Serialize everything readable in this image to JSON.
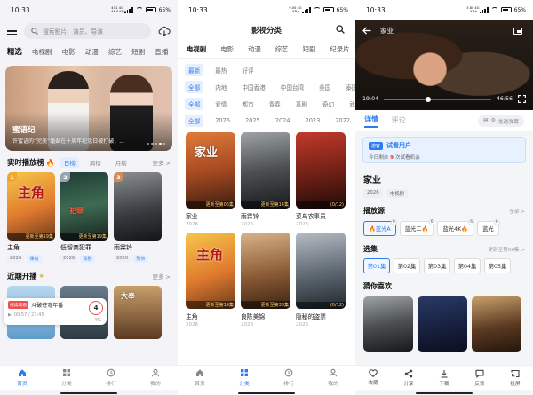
{
  "status": [
    {
      "time": "10:33",
      "net": "4G1 4G\n46.0 KB/s",
      "battery": "65%"
    },
    {
      "time": "10:33",
      "net": "9.00 4G\nKB/s",
      "battery": "65%"
    },
    {
      "time": "10:33",
      "net": "3.80 4G\nKB/s",
      "battery": "65%"
    }
  ],
  "home": {
    "search_placeholder": "搜索影片、演员、导演",
    "tabs": [
      "精选",
      "电视剧",
      "电影",
      "动漫",
      "综艺",
      "短剧",
      "直播"
    ],
    "hero": {
      "title": "蜜语纪",
      "subtitle": "许蜜语的“完美”婚姻在十周年纪念日被打破，..."
    },
    "hot": {
      "title": "实时播放榜",
      "chips": [
        "日榜",
        "周榜",
        "月榜"
      ],
      "more": "更多 >",
      "items": [
        {
          "rank": "1",
          "name": "主角",
          "update": "更新至第19集",
          "tags": [
            "2026",
            "保者"
          ],
          "rank_color": "#f2a72b"
        },
        {
          "rank": "2",
          "name": "低智商犯罪",
          "update": "更新至第19集",
          "tags": [
            "2026",
            "喜剧"
          ],
          "rank_color": "#9aa3b4"
        },
        {
          "rank": "3",
          "name": "雨霖铃",
          "update": "",
          "tags": [
            "2026",
            "刑侦"
          ],
          "rank_color": "#d48b5a"
        }
      ]
    },
    "soon": {
      "title": "近期开播",
      "more": "更多 >"
    },
    "resume": {
      "badge": "继续观看",
      "title": "斗破苍穹年番",
      "time": "00:57 / 23:45",
      "episode": "4",
      "pct": "4%"
    },
    "nav": [
      "首页",
      "分类",
      "排行",
      "我的"
    ]
  },
  "category": {
    "title": "影视分类",
    "tabs": [
      "电视剧",
      "电影",
      "动漫",
      "综艺",
      "短剧",
      "纪录片"
    ],
    "filters": [
      [
        "最新",
        "最热",
        "好评"
      ],
      [
        "全部",
        "内地",
        "中国香港",
        "中国台湾",
        "美国",
        "泰国"
      ],
      [
        "全部",
        "爱情",
        "都市",
        "青春",
        "喜剧",
        "奇幻",
        "武侠"
      ],
      [
        "全部",
        "2026",
        "2025",
        "2024",
        "2023",
        "2022",
        "202"
      ]
    ],
    "items": [
      {
        "name": "家业",
        "update": "更新至第06集",
        "year": "2026"
      },
      {
        "name": "雨霖铃",
        "update": "更新至第14集",
        "year": "2026"
      },
      {
        "name": "菜鸟农事员",
        "update": "(0/12)",
        "year": "2026"
      },
      {
        "name": "主角",
        "update": "更新至第19集",
        "year": "2026"
      },
      {
        "name": "良陈美锦",
        "update": "更新至第30集",
        "year": "2026"
      },
      {
        "name": "隐秘的盗票",
        "update": "(0/12)",
        "year": "2026"
      }
    ],
    "nav": [
      "首页",
      "分类",
      "排行",
      "我的"
    ]
  },
  "detail": {
    "video": {
      "title": "家业",
      "elapsed": "19:04",
      "total": "46:56",
      "progress": 0.41
    },
    "tabs": [
      "详情",
      "评论"
    ],
    "danmaku_label": "发送弹幕",
    "trial": {
      "badge": "游客",
      "name": "试看用户",
      "text_pre": "今日剩余",
      "count": "9",
      "text_post": "次试看机会"
    },
    "title": "家业",
    "tags": [
      "2026",
      "电视剧"
    ],
    "source_label": "播放源",
    "source_more": "全部 >",
    "sources": [
      {
        "name": "🔥蓝光A",
        "badge": "6"
      },
      {
        "name": "蓝光二🔥",
        "badge": "6"
      },
      {
        "name": "蓝光4K🔥",
        "badge": "6"
      },
      {
        "name": "蓝光",
        "badge": "6"
      }
    ],
    "episode_label": "选集",
    "episode_more": "更新至第06集 >",
    "episodes": [
      "第01集",
      "第02集",
      "第03集",
      "第04集",
      "第05集"
    ],
    "recommend_label": "猜你喜欢",
    "nav": [
      "收藏",
      "分享",
      "下载",
      "反馈",
      "投屏"
    ]
  }
}
